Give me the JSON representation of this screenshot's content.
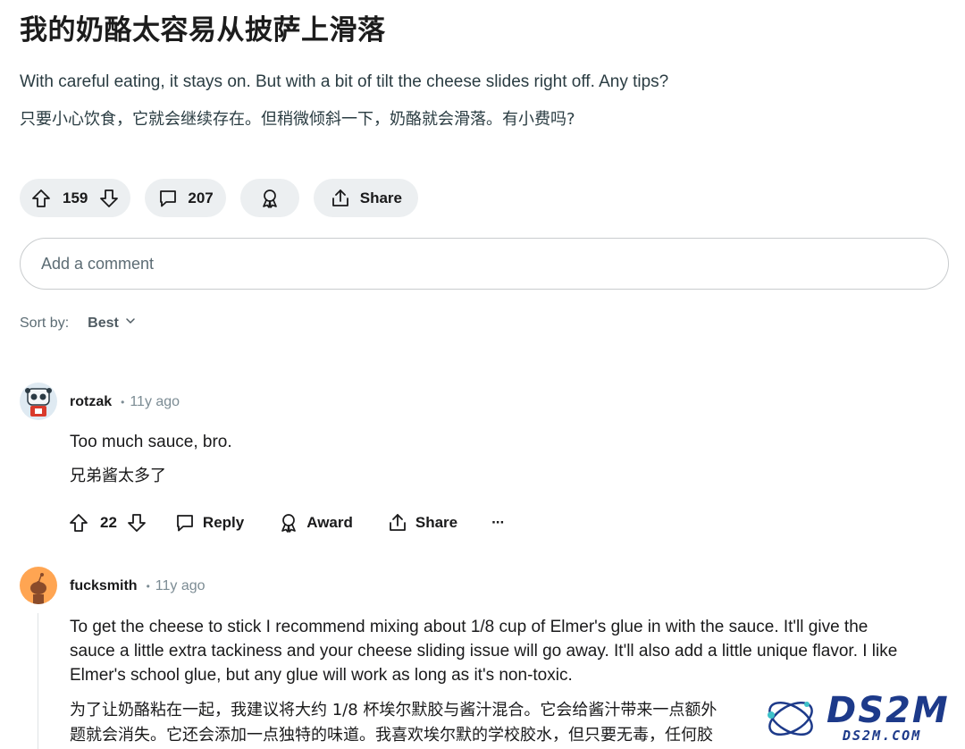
{
  "post": {
    "title": "我的奶酪太容易从披萨上滑落",
    "body_en": "With careful eating, it stays on. But with a bit of tilt the cheese slides right off. Any tips?",
    "body_zh": "只要小心饮食，它就会继续存在。但稍微倾斜一下，奶酪就会滑落。有小费吗?",
    "votes": "159",
    "comments": "207",
    "share_label": "Share"
  },
  "comment_box": {
    "placeholder": "Add a comment"
  },
  "sort": {
    "label": "Sort by:",
    "value": "Best"
  },
  "comments": [
    {
      "author": "rotzak",
      "age": "11y ago",
      "text_en": "Too much sauce, bro.",
      "text_zh": "兄弟酱太多了",
      "votes": "22",
      "reply_label": "Reply",
      "award_label": "Award",
      "share_label": "Share",
      "more_label": "···"
    },
    {
      "author": "fucksmith",
      "age": "11y ago",
      "text_en_1": "To get the cheese to stick I recommend mixing about 1/8 cup of Elmer's glue in with the sauce. It'll give the",
      "text_en_2": "sauce a little extra tackiness and your cheese sliding issue will go away. It'll also add a little unique flavor. I like",
      "text_en_3": "Elmer's school glue, but any glue will work as long as it's non-toxic.",
      "text_zh_1": "为了让奶酪粘在一起，我建议将大约 1/8 杯埃尔默胶与酱汁混合。它会给酱汁带来一点额外",
      "text_zh_2": "题就会消失。它还会添加一点独特的味道。我喜欢埃尔默的学校胶水，但只要无毒，任何胶"
    }
  ],
  "watermark": {
    "brand": "DS2M",
    "site": "DS2M.COM"
  },
  "colors": {
    "pill_bg": "#eceff1",
    "text": "#1a1a1b",
    "muted": "#5c6c74",
    "watermark_blue": "#1d3a8a"
  },
  "icons": [
    "upvote-icon",
    "downvote-icon",
    "comment-bubble-icon",
    "award-icon",
    "share-icon",
    "chevron-down-icon",
    "more-icon"
  ]
}
